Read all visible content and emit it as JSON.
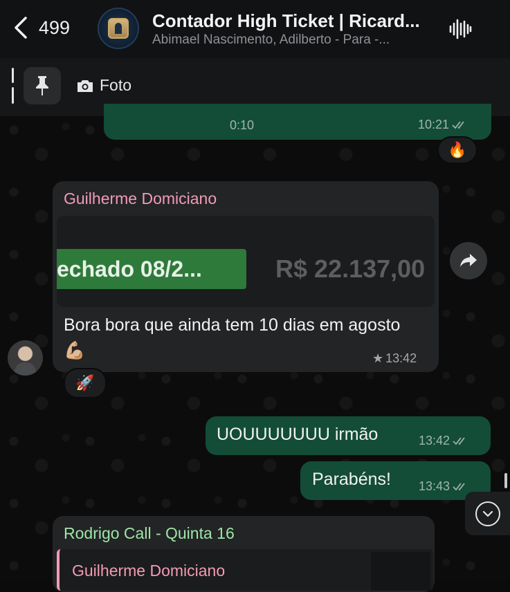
{
  "header": {
    "back_count": "499",
    "title": "Contador High Ticket | Ricard...",
    "subtitle": "Abimael Nascimento, Adilberto - Para -..."
  },
  "pinned": {
    "preview_label": "Foto"
  },
  "messages": {
    "audio": {
      "duration": "0:10",
      "time": "10:21",
      "reaction": "🔥"
    },
    "guilherme": {
      "sender": "Guilherme Domiciano",
      "image_left_text": "echado 08/2...",
      "image_right_text": "R$ 22.137,00",
      "text": "Bora bora que ainda tem 10 dias em agosto 💪🏼",
      "star": "★",
      "time": "13:42",
      "reaction": "🚀"
    },
    "out1": {
      "text": "UOUUUUUUU irmão",
      "time": "13:42"
    },
    "out2": {
      "text": "Parabéns!",
      "time": "13:43"
    },
    "rodrigo": {
      "sender": "Rodrigo Call - Quinta 16",
      "quoted_sender": "Guilherme Domiciano"
    }
  },
  "colors": {
    "outgoing_bubble": "#134d37",
    "incoming_bubble": "#232426",
    "sender_pink": "#f29bb5",
    "sender_green": "#9de6a6",
    "tick_color": "#9fb1a8"
  },
  "icons": {
    "back": "chevron-left-icon",
    "voice_call": "audio-waveform-icon",
    "pin": "pin-icon",
    "camera": "camera-icon",
    "forward": "forward-arrow-icon",
    "scroll_down": "chevron-down-icon"
  }
}
